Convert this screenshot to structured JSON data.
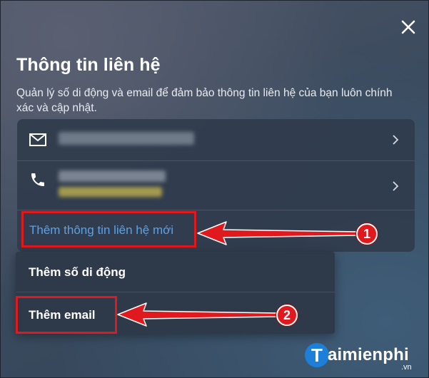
{
  "dialog": {
    "title": "Thông tin liên hệ",
    "subtitle": "Quản lý số di động và email để đảm bảo thông tin liên hệ của bạn luôn chính xác và cập nhật.",
    "close_icon": "close-icon"
  },
  "contacts": [
    {
      "type": "email",
      "icon": "mail-icon",
      "value_hidden": true
    },
    {
      "type": "phone",
      "icon": "phone-icon",
      "value_hidden": true
    }
  ],
  "add_contact_label": "Thêm thông tin liên hệ mới",
  "add_menu": {
    "items": [
      {
        "label": "Thêm số di động"
      },
      {
        "label": "Thêm email"
      }
    ]
  },
  "annotations": {
    "step1": "1",
    "step2": "2",
    "highlight_color": "#e0191e"
  },
  "watermark": {
    "initial": "T",
    "name": "aimienphi",
    "suffix": ".vn",
    "brand_color": "#1d7fd8"
  }
}
